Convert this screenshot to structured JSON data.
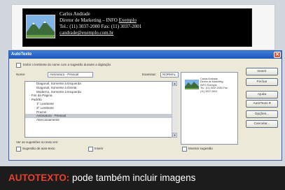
{
  "signature": {
    "line1": "Carlos Andrade",
    "line2": "Diretor de Marketing – INFO ",
    "line2_link": "Exemplo",
    "line3": "Tel.: (11) 3037-2000  Fax: (11) 3037-2001",
    "line4": "candrade@exemplo.com.br"
  },
  "dialog": {
    "title": "AutoTexto",
    "close_glyph": "✕",
    "option_checkbox_label": "Exibir o lembrete do nome com a sugestão durante a digitação",
    "name_label": "Nome:",
    "name_value": "Assinatura - Pessoal",
    "filter_label": "Examinar:",
    "filter_value": "NORMAL",
    "list_items": [
      "Diagonal, Somente à Esquerda",
      "Diagonal, Somente à Direita",
      "Moderno, Somente à Esquerda",
      "- Fim da Página",
      "- Padrão",
      "1º Lembrete",
      "2º Lembrete",
      "Prazos",
      "Assinatura - Pessoal",
      "Atenciosamente"
    ],
    "selected_index": 8,
    "scroll_up": "▲",
    "scroll_down": "▼",
    "preview_lines": [
      "Carlos Andrade",
      "Diretor de Marketing",
      "INFO Exemplo",
      "Tel.: (11) 3037-2000  Fax:",
      "(11) 3037-2001"
    ],
    "bottom_label": "Ver as sugestões no texto em:",
    "bottom_checks": [
      "Sugestão de auto-texto",
      "Inserir",
      "Mostrar sugestão"
    ],
    "buttons": [
      "Inserir",
      "Fechar",
      "Ajuda",
      "AutoTexto ▾",
      "Opções...",
      "Cancelar..."
    ]
  },
  "caption": {
    "keyword": "AUTOTEXTO:",
    "text": " pode também incluir imagens"
  },
  "colors": {
    "caption_keyword": "#e8402c",
    "titlebar": "#1e56b8",
    "signature_bg": "#000000"
  }
}
